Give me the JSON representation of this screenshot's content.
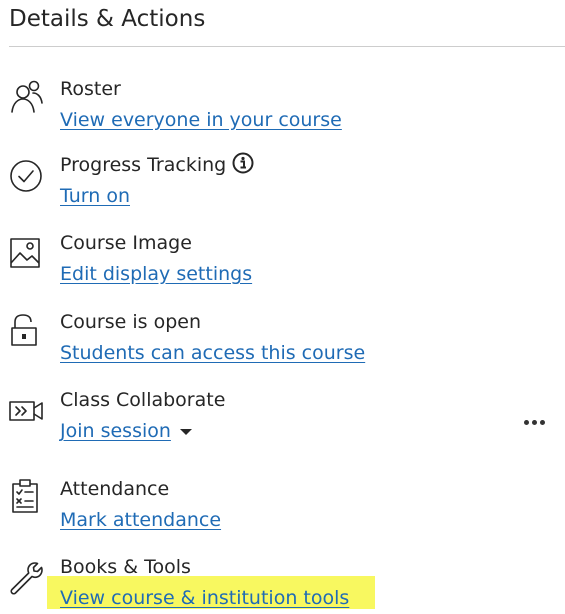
{
  "panel": {
    "title": "Details & Actions"
  },
  "items": [
    {
      "name": "roster",
      "icon": "users-icon",
      "label": "Roster",
      "link": "View everyone in your course"
    },
    {
      "name": "progress-tracking",
      "icon": "check-circle-icon",
      "label": "Progress Tracking",
      "link": "Turn on",
      "info_icon": "info-icon"
    },
    {
      "name": "course-image",
      "icon": "image-icon",
      "label": "Course Image",
      "link": "Edit display settings"
    },
    {
      "name": "course-status",
      "icon": "unlock-icon",
      "label": "Course is open",
      "link": "Students can access this course"
    },
    {
      "name": "class-collaborate",
      "icon": "video-camera-icon",
      "label": "Class Collaborate",
      "link": "Join session",
      "dropdown_icon": "caret-down-icon",
      "more_icon": "more-options-icon"
    },
    {
      "name": "attendance",
      "icon": "clipboard-checklist-icon",
      "label": "Attendance",
      "link": "Mark attendance"
    },
    {
      "name": "books-tools",
      "icon": "wrench-icon",
      "label": "Books & Tools",
      "link": "View course & institution tools",
      "highlighted": true
    }
  ],
  "colors": {
    "text": "#262626",
    "link": "#1f6bb5",
    "divider": "#cdcdcd",
    "highlight": "#f8f860"
  }
}
